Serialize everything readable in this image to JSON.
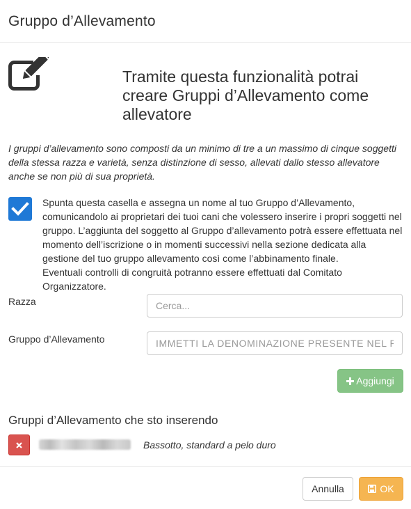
{
  "modal": {
    "title": "Gruppo d’Allevamento"
  },
  "intro": {
    "icon": "edit-icon",
    "heading": "Tramite questa funzionalità potrai creare Gruppi d’Allevamento come allevatore"
  },
  "description": "I gruppi d’allevamento sono composti da un minimo di tre a un massimo di cinque soggetti della stessa razza e varietà, senza distinzione di sesso, allevati dallo stesso allevatore anche se non più di sua proprietà.",
  "agreement": {
    "checked": true,
    "text": "Spunta questa casella e assegna un nome al tuo Gruppo d’Allevamento, comunicandolo ai proprietari dei tuoi cani che volessero inserire i propri soggetti nel gruppo. L’aggiunta del soggetto al Gruppo d’allevamento potrà essere effettuata nel momento dell’iscrizione o in momenti successivi nella sezione dedicata alla gestione del tuo gruppo allevamento così come l’abbinamento finale.",
    "text_line2": "Eventuali controlli di congruità potranno essere effettuati dal Comitato Organizzatore."
  },
  "form": {
    "breed_label": "Razza",
    "breed_placeholder": "Cerca...",
    "group_label": "Gruppo d’Allevamento",
    "group_placeholder": "IMMETTI LA DENOMINAZIONE PRESENTE NEL PEDIGREE",
    "add_label": "Aggiungi",
    "add_icon": "plus-icon"
  },
  "groups": {
    "title": "Gruppi d’Allevamento che sto inserendo",
    "entries": [
      {
        "breed": "Bassotto, standard a pelo duro",
        "delete_icon": "close-icon"
      }
    ]
  },
  "footer": {
    "cancel_label": "Annulla",
    "ok_label": "OK",
    "ok_icon": "save-icon"
  },
  "colors": {
    "checkbox": "#1f79d6",
    "add_button": "#86c486",
    "delete_button": "#d9534f",
    "ok_button": "#f5b551"
  }
}
